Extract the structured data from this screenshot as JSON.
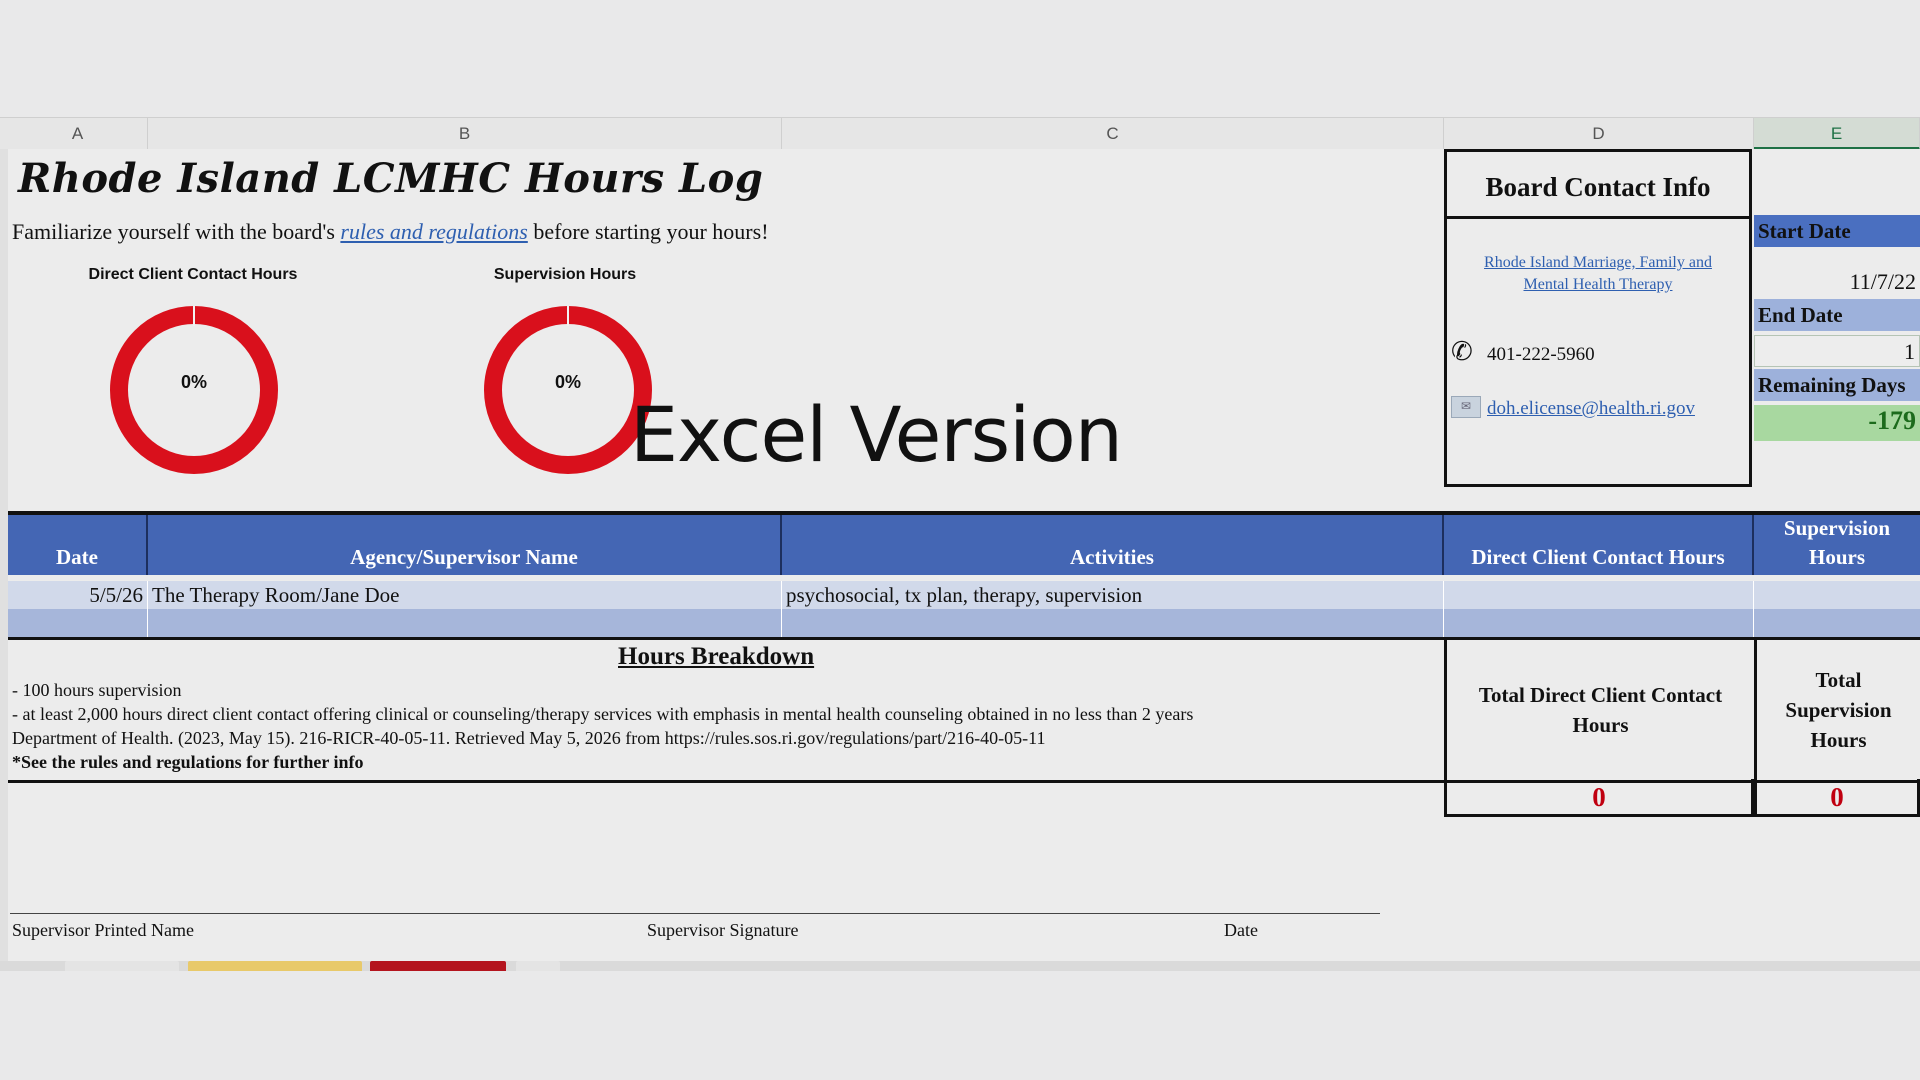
{
  "columns": [
    "A",
    "B",
    "C",
    "D",
    "E"
  ],
  "title": "Rhode Island LCMHC Hours Log",
  "intro": {
    "before": "Familiarize yourself with the board's ",
    "link": "rules and regulations",
    "after": " before starting your hours!"
  },
  "gauges": [
    {
      "title": "Direct Client Contact Hours",
      "value_label": "0%",
      "value": 0
    },
    {
      "title": "Supervision Hours",
      "value_label": "0%",
      "value": 0
    }
  ],
  "overlay_text": "Excel Version",
  "board": {
    "title": "Board Contact Info",
    "link": "Rhode Island Marriage, Family and Mental Health Therapy",
    "phone": "401-222-5960",
    "email": "doh.elicense@health.ri.gov"
  },
  "dates": {
    "start_label": "Start Date",
    "start_value": "11/7/22",
    "end_label": "End Date",
    "end_value": "1",
    "remaining_label": "Remaining Days",
    "remaining_value": "-179"
  },
  "table": {
    "headers": [
      "Date",
      "Agency/Supervisor Name",
      "Activities",
      "Direct Client Contact Hours",
      "Supervision Hours"
    ],
    "rows": [
      [
        "5/5/26",
        "The Therapy Room/Jane Doe",
        "psychosocial, tx plan, therapy, supervision",
        "",
        ""
      ],
      [
        "",
        "",
        "",
        "",
        ""
      ]
    ]
  },
  "breakdown": {
    "title": "Hours Breakdown",
    "lines": [
      "- 100 hours supervision",
      "- at least 2,000 hours direct client contact offering clinical or counseling/therapy services with emphasis in mental health counseling obtained in no less than 2 years",
      "Department of Health. (2023, May 15). 216-RICR-40-05-11. Retrieved May 5, 2026 from https://rules.sos.ri.gov/regulations/part/216-40-05-11",
      "*See the rules and regulations for further info"
    ],
    "total_direct_label": "Total Direct Client Contact Hours",
    "total_supervision_label": "Total Supervision Hours",
    "total_direct_value": "0",
    "total_supervision_value": "0"
  },
  "signature": {
    "printed_name": "Supervisor Printed Name",
    "signature": "Supervisor Signature",
    "date": "Date"
  },
  "colors": {
    "header_blue": "#4466b4",
    "ring_red": "#d9101c",
    "remaining_green": "#a8d8a0",
    "total_red": "#c00010"
  }
}
